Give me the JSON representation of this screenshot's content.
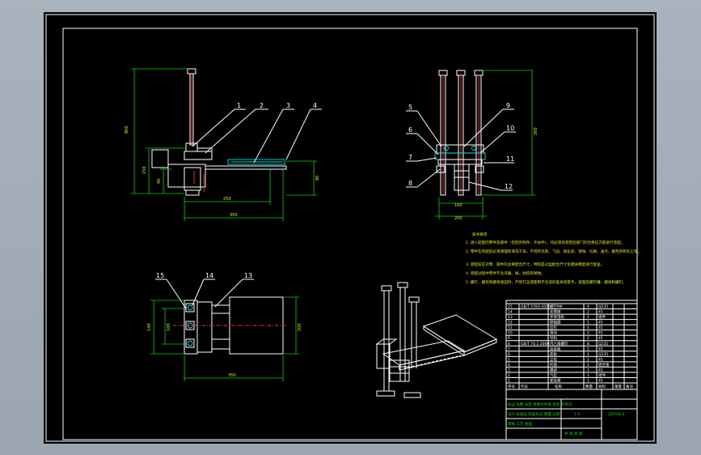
{
  "callouts": {
    "c1": "1",
    "c2": "2",
    "c3": "3",
    "c4": "4",
    "c5": "5",
    "c6": "6",
    "c7": "7",
    "c8": "8",
    "c9": "9",
    "c10": "10",
    "c11": "11",
    "c12": "12",
    "c13": "13",
    "c14": "14",
    "c15": "15"
  },
  "dimensions": {
    "front_height": "800",
    "front_mid": "150",
    "front_low": "40",
    "front_right": "80",
    "front_top_width": "250",
    "front_total_width": "350",
    "side_height": "300",
    "side_width1": "160",
    "side_width2": "200",
    "plan_height1": "140",
    "plan_height2": "100",
    "plan_right": "200",
    "plan_width": "350"
  },
  "notes": {
    "title": "技术要求",
    "lines": [
      "1. 进入装配的零件及部件（包括外购件、外协件），均必须具有检验部门的合格证方能进行装配。",
      "2. 零件在装配前必须清理和清洗干净，不得有毛刺、飞边、氧化皮、锈蚀、切屑、油污、着色剂和灰尘等。",
      "3. 装配前应对零、部件的主要配合尺寸，特别是过盈配合尺寸及相关精度进行复查。",
      "4. 装配过程中零件不允许磕、碰、划伤和锈蚀。",
      "5. 螺钉、螺栓和螺母紧固时，严禁打击或使用不合适的旋具和扳手。紧固后螺钉槽、螺母和螺钉。"
    ]
  },
  "title_block": {
    "drawing_no": "ZDY-01-0",
    "col_no": "序号",
    "col_code": "代号",
    "col_name": "名称",
    "col_qty": "数量",
    "col_material": "材料",
    "col_weight": "重量",
    "col_remark": "备注",
    "rows": [
      {
        "no": "15",
        "code": "GB/T 5783-2000",
        "name": "螺钉M6",
        "qty": "4",
        "mat": "Q235"
      },
      {
        "no": "14",
        "code": "",
        "name": "支撑座",
        "qty": "2",
        "mat": "45"
      },
      {
        "no": "13",
        "code": "",
        "name": "步进电机",
        "qty": "1",
        "mat": "组件"
      },
      {
        "no": "12",
        "code": "",
        "name": "联轴器",
        "qty": "1",
        "mat": "45"
      },
      {
        "no": "11",
        "code": "",
        "name": "丝杠",
        "qty": "1",
        "mat": "45"
      },
      {
        "no": "10",
        "code": "",
        "name": "滑块",
        "qty": "2",
        "mat": "45"
      },
      {
        "no": "9",
        "code": "",
        "name": "导轨",
        "qty": "2",
        "mat": "45"
      },
      {
        "no": "8",
        "code": "GB/T 70.1-2000",
        "name": "内六角螺钉",
        "qty": "8",
        "mat": "Q235"
      },
      {
        "no": "7",
        "code": "",
        "name": "连接板",
        "qty": "1",
        "mat": "45"
      },
      {
        "no": "6",
        "code": "",
        "name": "底板",
        "qty": "1",
        "mat": "Q235"
      },
      {
        "no": "5",
        "code": "",
        "name": "立柱",
        "qty": "2",
        "mat": "45"
      },
      {
        "no": "4",
        "code": "",
        "name": "托盘",
        "qty": "1",
        "mat": "铝合金"
      },
      {
        "no": "3",
        "code": "",
        "name": "横梁",
        "qty": "1",
        "mat": "45"
      },
      {
        "no": "2",
        "code": "",
        "name": "气缸",
        "qty": "1",
        "mat": "组件"
      },
      {
        "no": "1",
        "code": "",
        "name": "安装座",
        "qty": "1",
        "mat": "45"
      }
    ],
    "sign_row1": "标记 处数 分区 更改文件号 签名 年月日",
    "sign_row2": "设计 标准化 阶段标记 重量 比例",
    "sign_row3": "审核 工艺 批准",
    "scale": "1:5",
    "sheet": "共 张 第 张"
  }
}
